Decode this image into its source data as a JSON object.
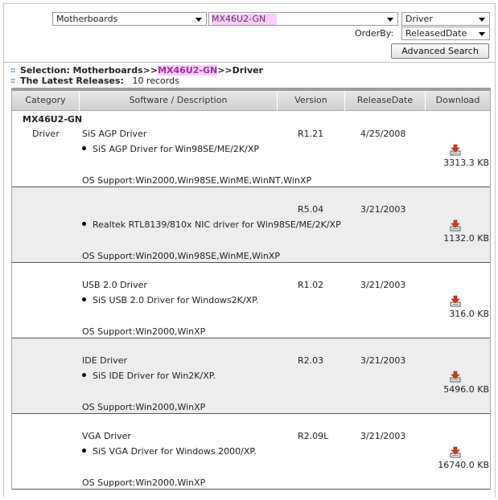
{
  "filters": {
    "category": "Motherboards",
    "model": "MX46U2-GN",
    "type": "Driver",
    "orderby_label": "OrderBy:",
    "orderby": "ReleasedDate",
    "advanced_search": "Advanced Search"
  },
  "info": {
    "selection_label": "Selection:",
    "selection_pre": "Motherboards>>",
    "selection_model": "MX46U2-GN",
    "selection_post": ">>Driver",
    "latest_label": "The Latest Releases:",
    "records": "10 records"
  },
  "table": {
    "columns": [
      "Category",
      "Software / Description",
      "Version",
      "ReleaseDate",
      "Download"
    ],
    "group": "MX46U2-GN",
    "rows": [
      {
        "category": "Driver",
        "title": "SiS AGP Driver",
        "description": "SiS AGP Driver for Win98SE/ME/2K/XP",
        "os": "OS Support:Win2000,Win98SE,WinME,WinNT,WinXP",
        "version": "R1.21",
        "date": "4/25/2008",
        "size": "3313.3 KB"
      },
      {
        "category": "",
        "title": "",
        "description": "Realtek RTL8139/810x NIC driver for Win98SE/ME/2K/XP",
        "os": "OS Support:Win2000,Win98SE,WinME,WinXP",
        "version": "R5.04",
        "date": "3/21/2003",
        "size": "1132.0 KB"
      },
      {
        "category": "",
        "title": "USB 2.0 Driver",
        "description": "SiS USB 2.0 Driver for Windows2K/XP.",
        "os": "OS Support:Win2000,WinXP",
        "version": "R1.02",
        "date": "3/21/2003",
        "size": "316.0 KB"
      },
      {
        "category": "",
        "title": "IDE Driver",
        "description": "SiS IDE Driver for Win2K/XP.",
        "os": "OS Support:Win2000,WinXP",
        "version": "R2.03",
        "date": "3/21/2003",
        "size": "5496.0 KB"
      },
      {
        "category": "",
        "title": "VGA Driver",
        "description": "SiS VGA Driver for Windows 2000/XP.",
        "os": "OS Support:Win2000,WinXP",
        "version": "R2.09L",
        "date": "3/21/2003",
        "size": "16740.0 KB"
      }
    ]
  },
  "colors": {
    "highlight_bg": "#ffccff",
    "highlight_text": "#993399",
    "header_bg": "#d8d8d8",
    "alt_row_bg": "#ededed",
    "bullet_blue": "#4c88c8"
  },
  "icons": {
    "download": "download-icon",
    "dropdown": "chevron-down-icon",
    "section_bullet": "square-bullet-icon"
  }
}
